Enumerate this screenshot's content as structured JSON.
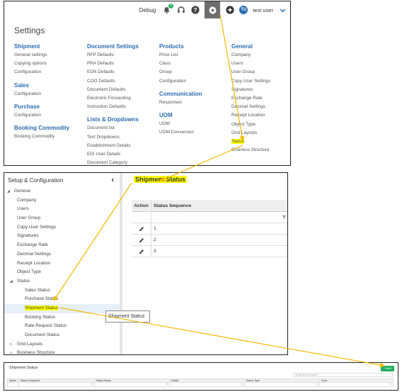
{
  "topbar": {
    "debug": "Debug",
    "bell_badge": "5",
    "avatar_initials": "TU",
    "user": "test user"
  },
  "settings": {
    "title": "Settings",
    "columns": [
      {
        "sections": [
          {
            "heading": "Shipment",
            "items": [
              "General settings",
              "Copying options",
              "Configuration"
            ]
          },
          {
            "heading": "Sales",
            "items": [
              "Configuration"
            ]
          },
          {
            "heading": "Purchase",
            "items": [
              "Configuration"
            ]
          },
          {
            "heading": "Booking Commodity",
            "items": [
              "Booking Commodity"
            ]
          }
        ]
      },
      {
        "sections": [
          {
            "heading": "Document Settings",
            "items": [
              "RFP Defaults",
              "PRA Defaults",
              "EDN Defaults",
              "COO Defaults",
              "Document Defaults",
              "Electronic Forwarding",
              "Instruction Defaults"
            ]
          },
          {
            "heading": "Lists & Dropdowns",
            "items": [
              "Document list",
              "Text Dropdowns",
              "Establishment Details",
              "EDI User Details",
              "Document Category"
            ]
          }
        ]
      },
      {
        "sections": [
          {
            "heading": "Products",
            "items": [
              "Price List",
              "Class",
              "Group",
              "Configuration"
            ]
          },
          {
            "heading": "Communication",
            "items": [
              "Responses"
            ]
          },
          {
            "heading": "UOM",
            "items": [
              "UOM",
              "UOM Conversion"
            ]
          }
        ]
      },
      {
        "sections": [
          {
            "heading": "General",
            "items": [
              "Company",
              "Users",
              "User Group",
              "Copy User Settings",
              "Signatures",
              "Exchange Rate",
              "Decimal Settings",
              "Receipt Location",
              "Object Type",
              "Grid Layouts",
              "Status",
              "Business Structure"
            ]
          }
        ]
      }
    ],
    "highlighted_item": "Status"
  },
  "setup": {
    "title": "Setup & Configuration",
    "collapse_glyph": "‹",
    "tree": [
      {
        "label": "General",
        "level": 0,
        "caret": "◢"
      },
      {
        "label": "Company",
        "level": 1
      },
      {
        "label": "Users",
        "level": 1
      },
      {
        "label": "User Group",
        "level": 1
      },
      {
        "label": "Copy User Settings",
        "level": 1
      },
      {
        "label": "Signatures",
        "level": 1
      },
      {
        "label": "Exchange Rate",
        "level": 1
      },
      {
        "label": "Decimal Settings",
        "level": 1
      },
      {
        "label": "Receipt Location",
        "level": 1
      },
      {
        "label": "Object Type",
        "level": 1
      },
      {
        "label": "Status",
        "level": 1,
        "caret": "◢"
      },
      {
        "label": "Sales Status",
        "level": 2
      },
      {
        "label": "Purchase Status",
        "level": 2
      },
      {
        "label": "Shipment Status",
        "level": 2,
        "selected": true
      },
      {
        "label": "Booking Status",
        "level": 2
      },
      {
        "label": "Rate Request Status",
        "level": 2
      },
      {
        "label": "Document Status",
        "level": 2
      },
      {
        "label": "Grid Layouts",
        "level": 1,
        "caret": "▷"
      },
      {
        "label": "Business Structure",
        "level": 1,
        "caret": "▷"
      }
    ],
    "tooltip": "Shipment Status",
    "main_title": "Shipment Status",
    "grid": {
      "columns": [
        "Action",
        "Status Sequence"
      ],
      "rows": [
        "1",
        "2",
        "3"
      ]
    }
  },
  "shipment_grid": {
    "title": "Shipment Status",
    "add_label": "+ Add",
    "search_placeholder": "Enter text to search...",
    "columns": [
      "Action",
      "Status Sequence",
      "Status Name",
      "Visible",
      "Status Type",
      "Color"
    ]
  },
  "colors": {
    "accent": "#2a6db0",
    "highlight": "#ffff00",
    "arrow": "#f5b800",
    "add_button": "#27ae60"
  }
}
